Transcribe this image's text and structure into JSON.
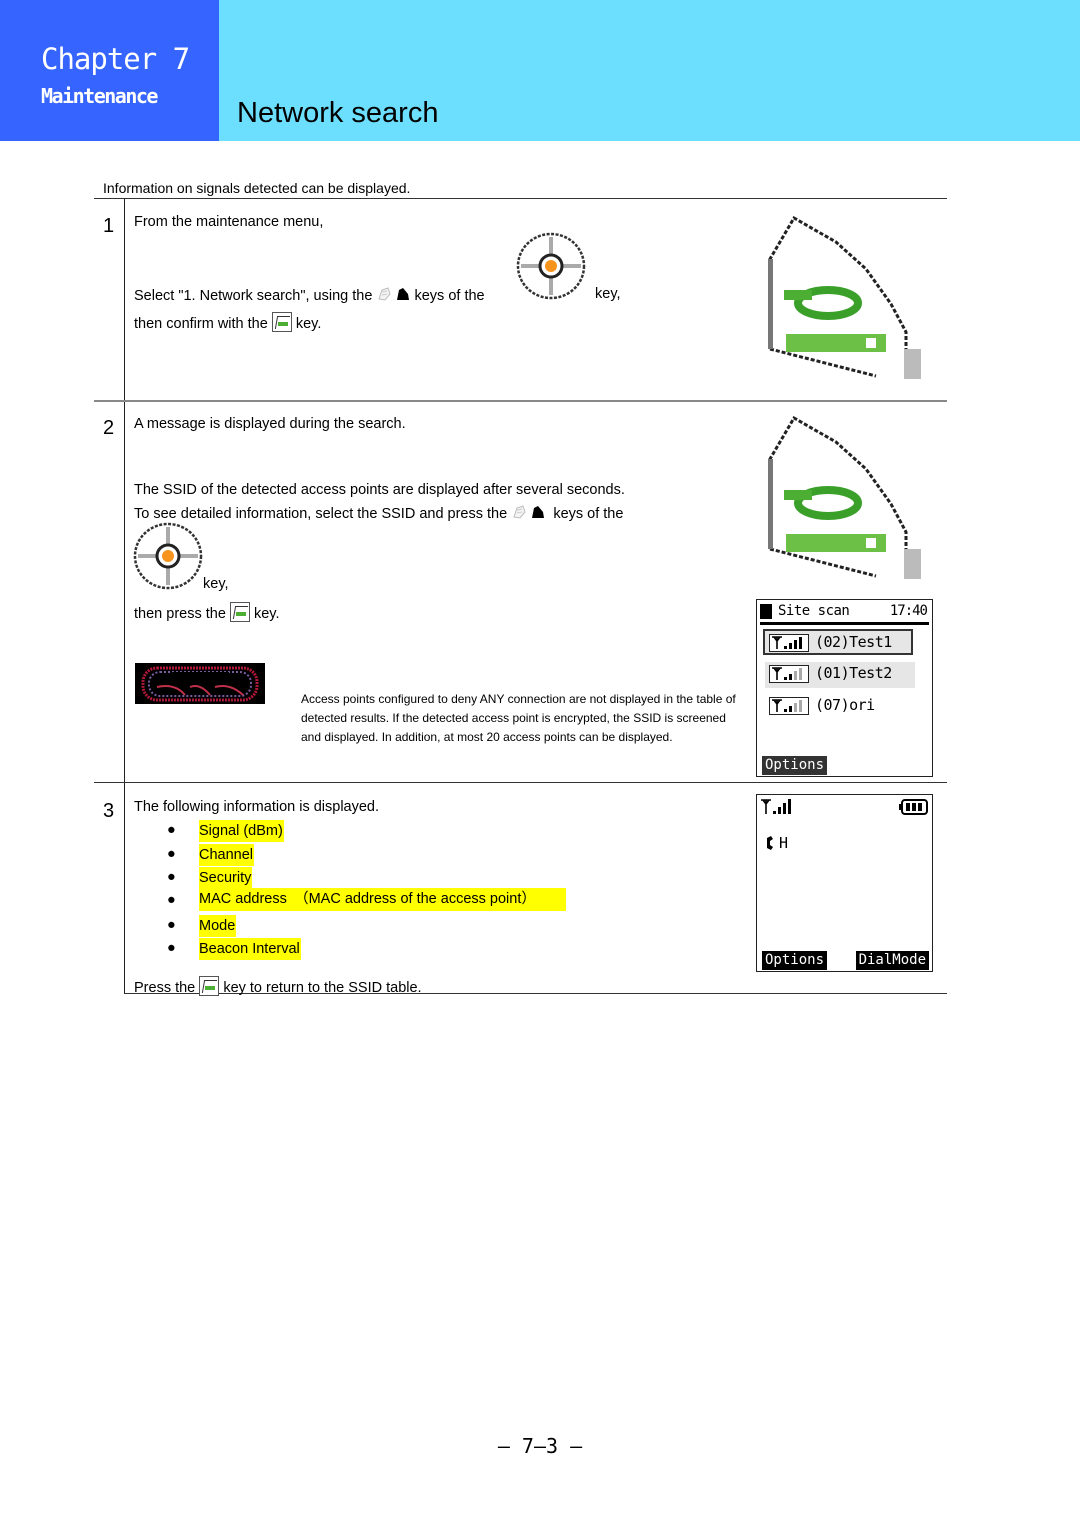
{
  "header": {
    "chapter": "Chapter 7",
    "section": "Maintenance",
    "title": "Network search",
    "colors": {
      "chapter_bg": "#3565fe",
      "title_bg": "#6ddffe",
      "highlight": "#ffff00"
    }
  },
  "intro": "Information on signals detected can be displayed.",
  "steps": [
    {
      "number": "1",
      "line1": "From the maintenance menu,",
      "line2_pre": "Select \"1. Network search\", using the",
      "line2_mid": "keys of the",
      "line2_post": "key,",
      "line3_pre": "then confirm with the",
      "line3_post": "key."
    },
    {
      "number": "2",
      "line1": "A message is displayed during the search.",
      "line2": "The SSID of the detected access points are displayed after several seconds.",
      "line3_pre": "To see detailed information, select the SSID and press the",
      "line3_post": "keys of the",
      "line4": "key,",
      "line5_pre": "then press the",
      "line5_post": "key.",
      "note": "Access points configured to deny ANY connection are not displayed in the table of detected results. If the detected access point is encrypted, the SSID is screened and displayed. In addition, at most 20 access points can be displayed.",
      "screen": {
        "title": "Site scan",
        "time": "17:40",
        "access_points": [
          {
            "label": "(02)Test1",
            "signal_bars": 4,
            "selected": true
          },
          {
            "label": "(01)Test2",
            "signal_bars": 2,
            "selected": false
          },
          {
            "label": "(07)ori",
            "signal_bars": 2,
            "selected": false
          }
        ],
        "softkey_left": "Options"
      }
    },
    {
      "number": "3",
      "line1": "The following information is displayed.",
      "bullets": [
        "Signal (dBm)",
        "Channel",
        "Security",
        "MAC address　（MAC address of the access point）",
        "Mode",
        "Beacon Interval"
      ],
      "footer_pre": "Press the",
      "footer_post": "key to return to the SSID table.",
      "screen": {
        "status_text": "H",
        "softkey_left": "Options",
        "softkey_right": "DialMode"
      }
    }
  ],
  "page_number": "–  7–3  –"
}
